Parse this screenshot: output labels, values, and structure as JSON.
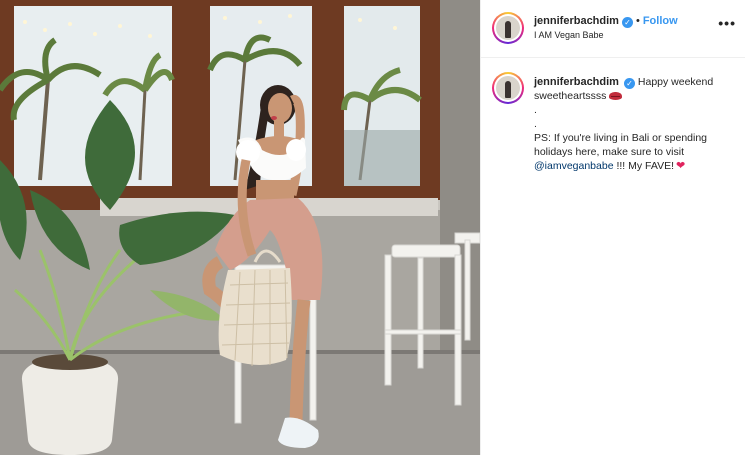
{
  "post": {
    "username": "jenniferbachdim",
    "verified": true,
    "dot": "•",
    "follow_label": "Follow",
    "location": "I AM Vegan Babe",
    "more_label": "•••"
  },
  "caption": {
    "username": "jenniferbachdim",
    "line1": "Happy weekend sweetheartssss",
    "dot1": ".",
    "dot2": ".",
    "line2": "PS: If you're living in Bali or spending holidays here, make sure to visit",
    "mention": "@iamveganbabe",
    "line3": " !!! My FAVE!",
    "icons": [
      "lips-emoji",
      "heart-emoji"
    ]
  },
  "colors": {
    "follow": "#3897f0",
    "verified": "#3897f0",
    "mention": "#00376b",
    "heart": "#e0245e"
  }
}
